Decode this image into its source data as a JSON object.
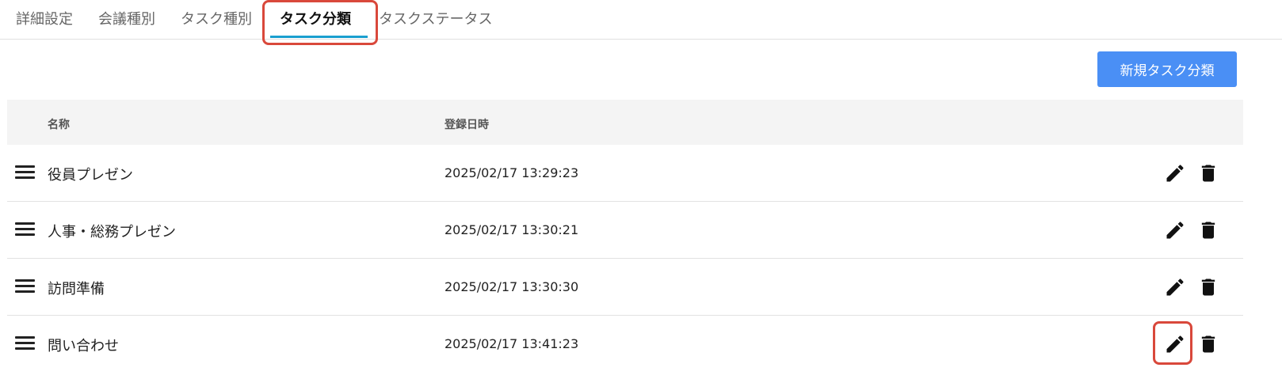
{
  "tabs": [
    {
      "label": "詳細設定"
    },
    {
      "label": "会議種別"
    },
    {
      "label": "タスク種別"
    },
    {
      "label": "タスク分類"
    },
    {
      "label": "タスクステータス"
    }
  ],
  "active_tab": "タスク分類",
  "toolbar": {
    "new_button_label": "新規タスク分類"
  },
  "table": {
    "columns": [
      "名称",
      "登録日時"
    ],
    "rows": [
      {
        "name": "役員プレゼン",
        "registered_at": "2025/02/17 13:29:23"
      },
      {
        "name": "人事・総務プレゼン",
        "registered_at": "2025/02/17 13:30:21"
      },
      {
        "name": "訪問準備",
        "registered_at": "2025/02/17 13:30:30"
      },
      {
        "name": "問い合わせ",
        "registered_at": "2025/02/17 13:41:23"
      }
    ]
  },
  "icons": {
    "row_handle": "drag-handle-icon",
    "edit": "pencil-icon",
    "delete": "trash-icon"
  },
  "colors": {
    "accent": "#1a9fcf",
    "primary_button": "#4a8ff5",
    "highlight": "#d9483b",
    "header_bg": "#f4f4f4"
  }
}
